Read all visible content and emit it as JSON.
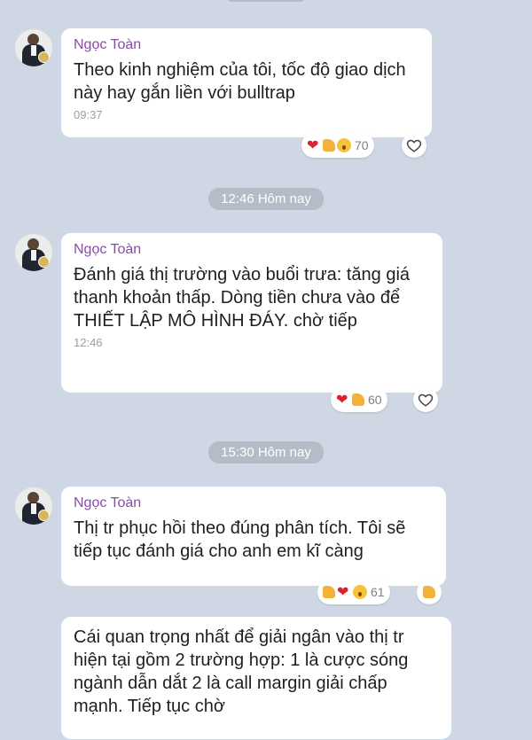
{
  "pills": {
    "first": "12:46 Hôm nay",
    "second": "15:30 Hôm nay"
  },
  "messages": [
    {
      "sender": "Ngọc Toàn",
      "text": "Theo kinh nghiệm của tôi, tốc độ giao dịch này hay gắn liền với bulltrap",
      "time": "09:37",
      "reaction_count": "70",
      "reactions": [
        "heart-icon",
        "thumbs-up-icon",
        "wow-face-icon"
      ]
    },
    {
      "sender": "Ngọc Toàn",
      "text": "Đánh giá thị trường vào buổi trưa: tăng giá thanh khoản thấp. Dòng tiền chưa vào để THIẾT LẬP MÔ HÌNH ĐÁY. chờ tiếp",
      "time": "12:46",
      "reaction_count": "60",
      "reactions": [
        "heart-icon",
        "thumbs-up-icon"
      ]
    },
    {
      "sender": "Ngọc Toàn",
      "text": "Thị tr phục hồi theo đúng phân tích. Tôi sẽ tiếp tục đánh giá cho anh em kĩ càng",
      "reaction_count": "61",
      "reactions": [
        "thumbs-up-icon",
        "heart-icon",
        "wow-face-icon"
      ]
    },
    {
      "text": "Cái quan trọng nhất để giải ngân vào thị tr hiện tại gồm 2 trường hợp: 1 là cược sóng ngành dẫn dắt 2 là call margin giải chấp mạnh. Tiếp tục chờ"
    }
  ]
}
